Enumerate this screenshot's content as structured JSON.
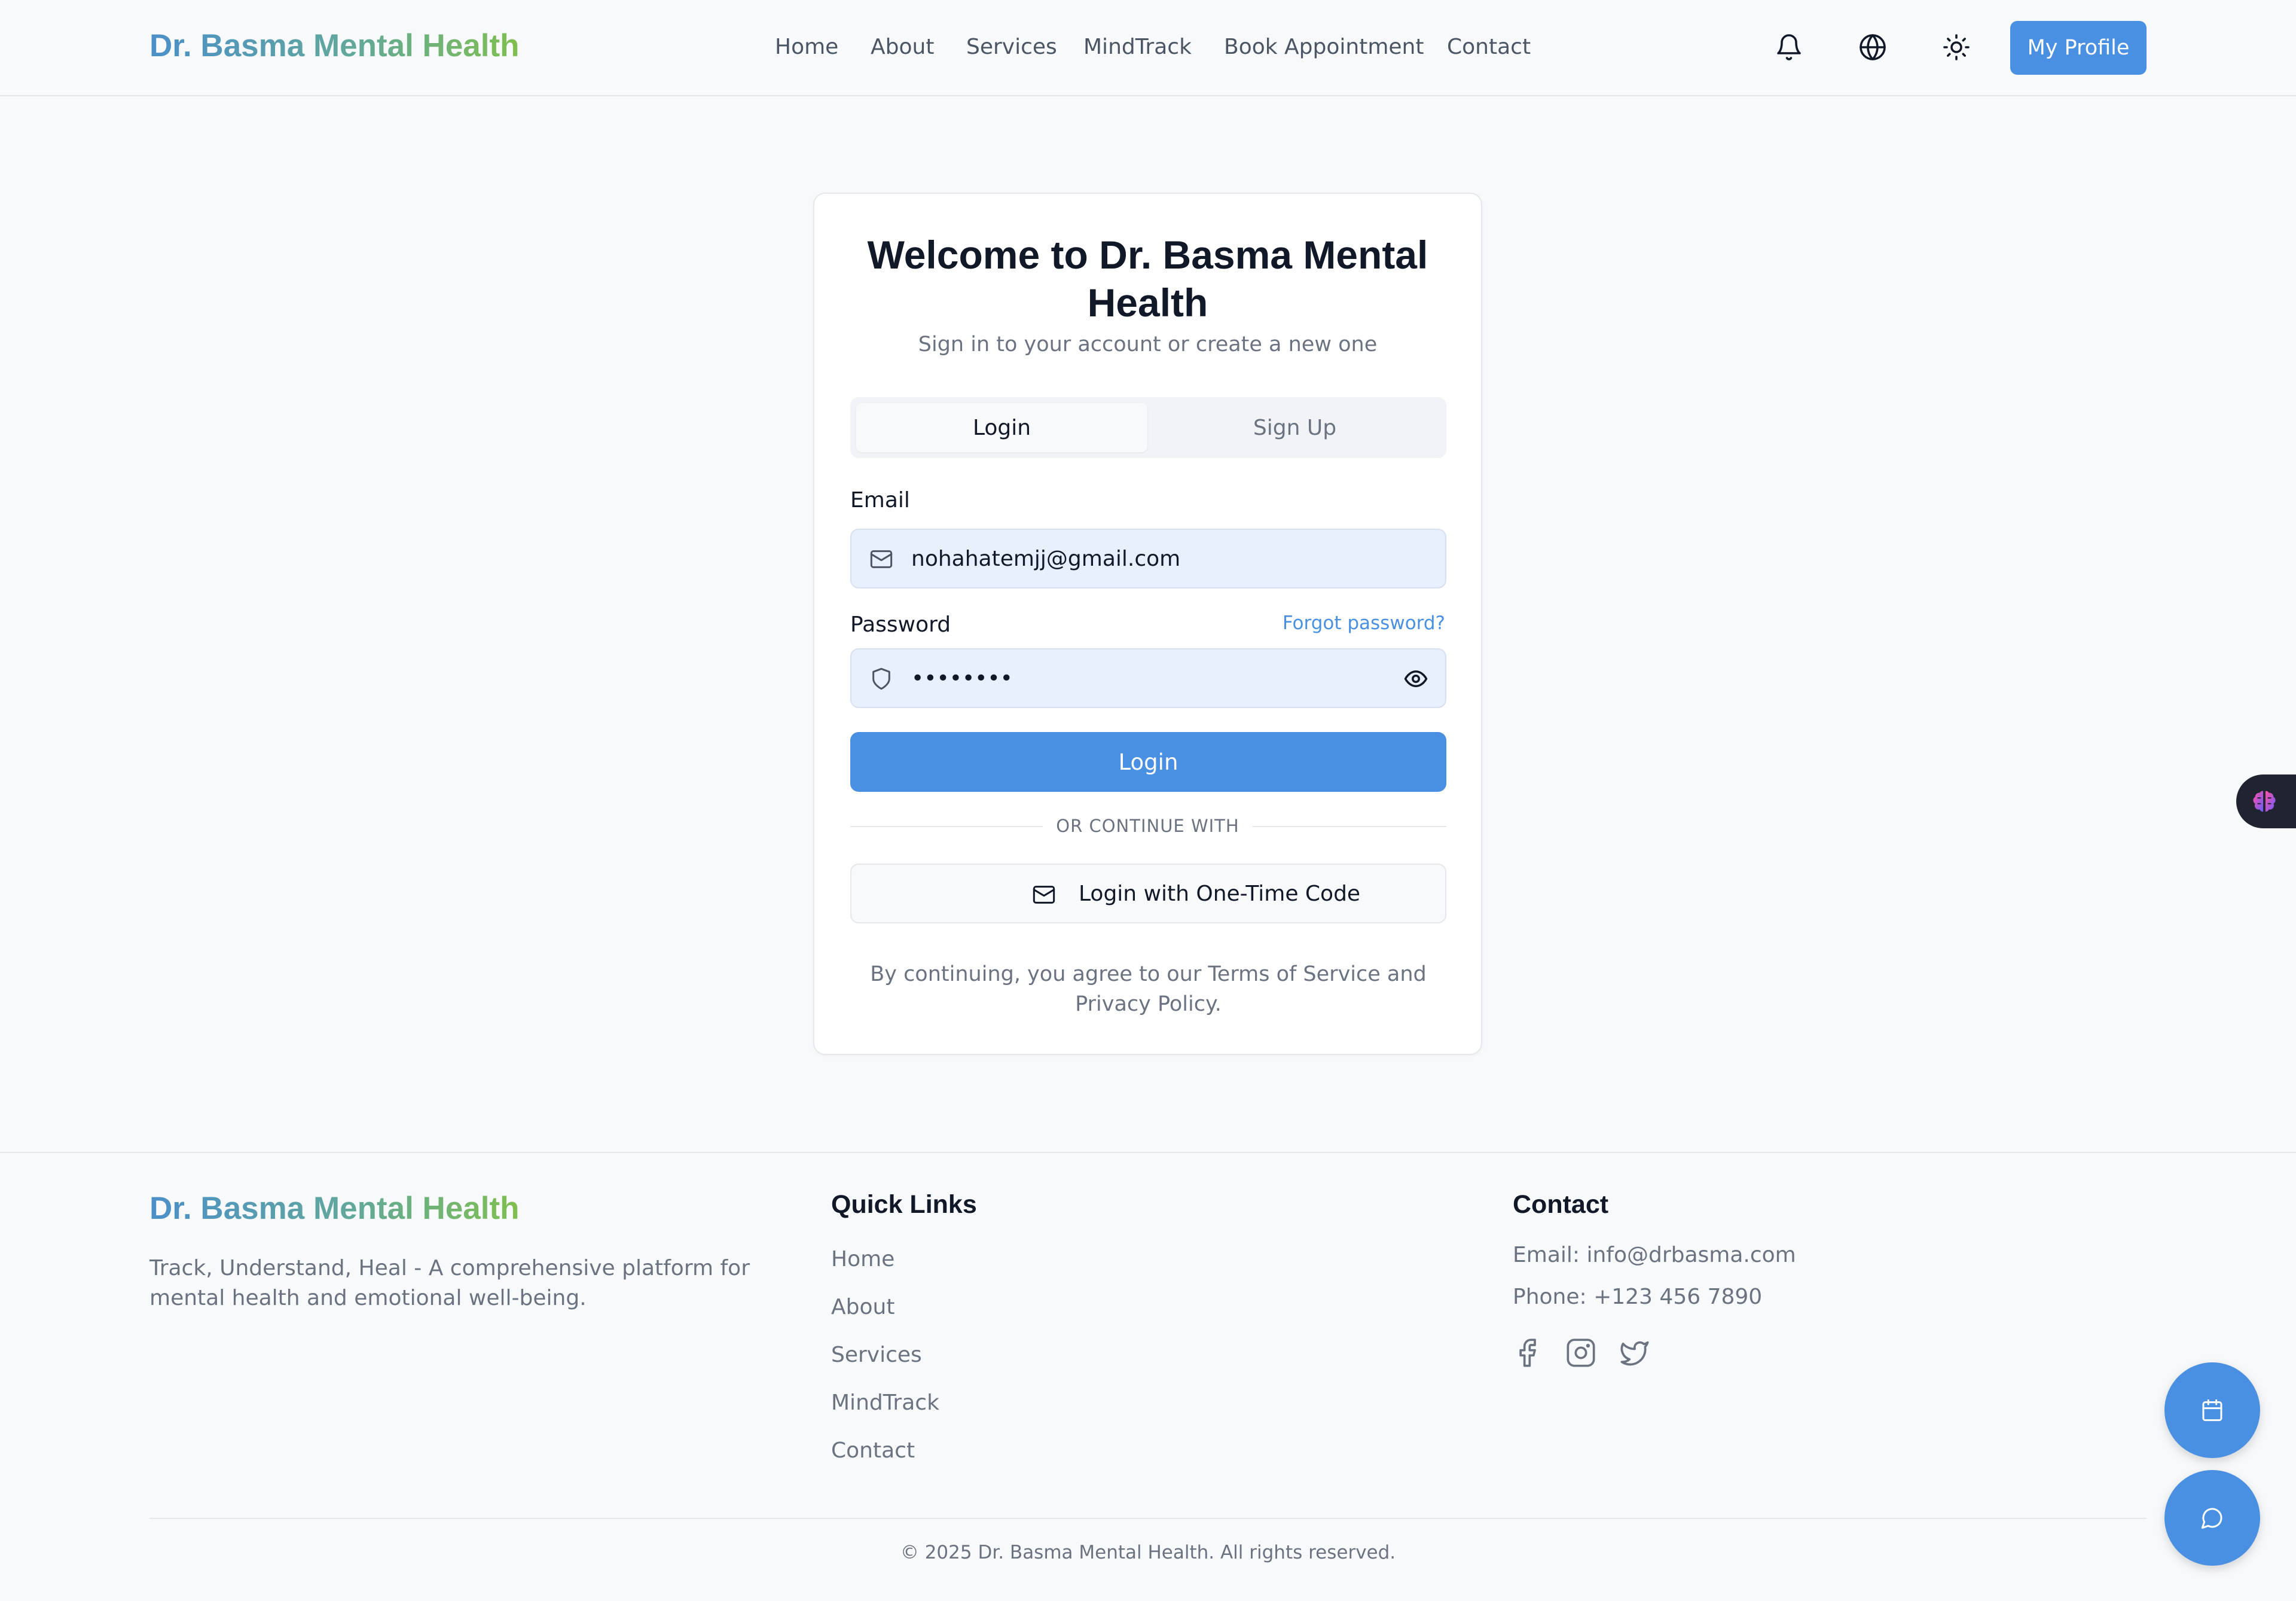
{
  "header": {
    "brand": "Dr. Basma Mental Health",
    "nav": [
      "Home",
      "About",
      "Services",
      "MindTrack",
      "Book Appointment",
      "Contact"
    ],
    "profile_button": "My Profile",
    "icons": [
      "bell-icon",
      "globe-icon",
      "sun-icon"
    ]
  },
  "auth": {
    "title": "Welcome to Dr. Basma Mental Health",
    "subtitle": "Sign in to your account or create a new one",
    "tabs": {
      "login": "Login",
      "signup": "Sign Up",
      "active": "Login"
    },
    "email_label": "Email",
    "email_value": "nohahatemjj@gmail.com",
    "password_label": "Password",
    "forgot_password": "Forgot password?",
    "password_value": "••••••••",
    "login_button": "Login",
    "divider": "OR CONTINUE WITH",
    "otp_button": "Login with One-Time Code",
    "terms": "By continuing, you agree to our Terms of Service and Privacy Policy."
  },
  "footer": {
    "brand": "Dr. Basma Mental Health",
    "description": "Track, Understand, Heal - A comprehensive platform for mental health and emotional well-being.",
    "quick_links_heading": "Quick Links",
    "quick_links": [
      "Home",
      "About",
      "Services",
      "MindTrack",
      "Contact"
    ],
    "contact_heading": "Contact",
    "email": "Email: info@drbasma.com",
    "phone": "Phone: +123 456 7890",
    "social_icons": [
      "facebook-icon",
      "instagram-icon",
      "twitter-icon"
    ],
    "copyright": "© 2025 Dr. Basma Mental Health. All rights reserved."
  },
  "floating": {
    "side_tab_icon": "brain-icon",
    "fab_icons": [
      "calendar-icon",
      "chat-icon"
    ]
  },
  "colors": {
    "accent": "#4a90e2",
    "brand_gradient_start": "#4b8fc9",
    "brand_gradient_end": "#7fbf50",
    "input_background": "#e8effd",
    "side_tab_background": "#1f2430"
  }
}
